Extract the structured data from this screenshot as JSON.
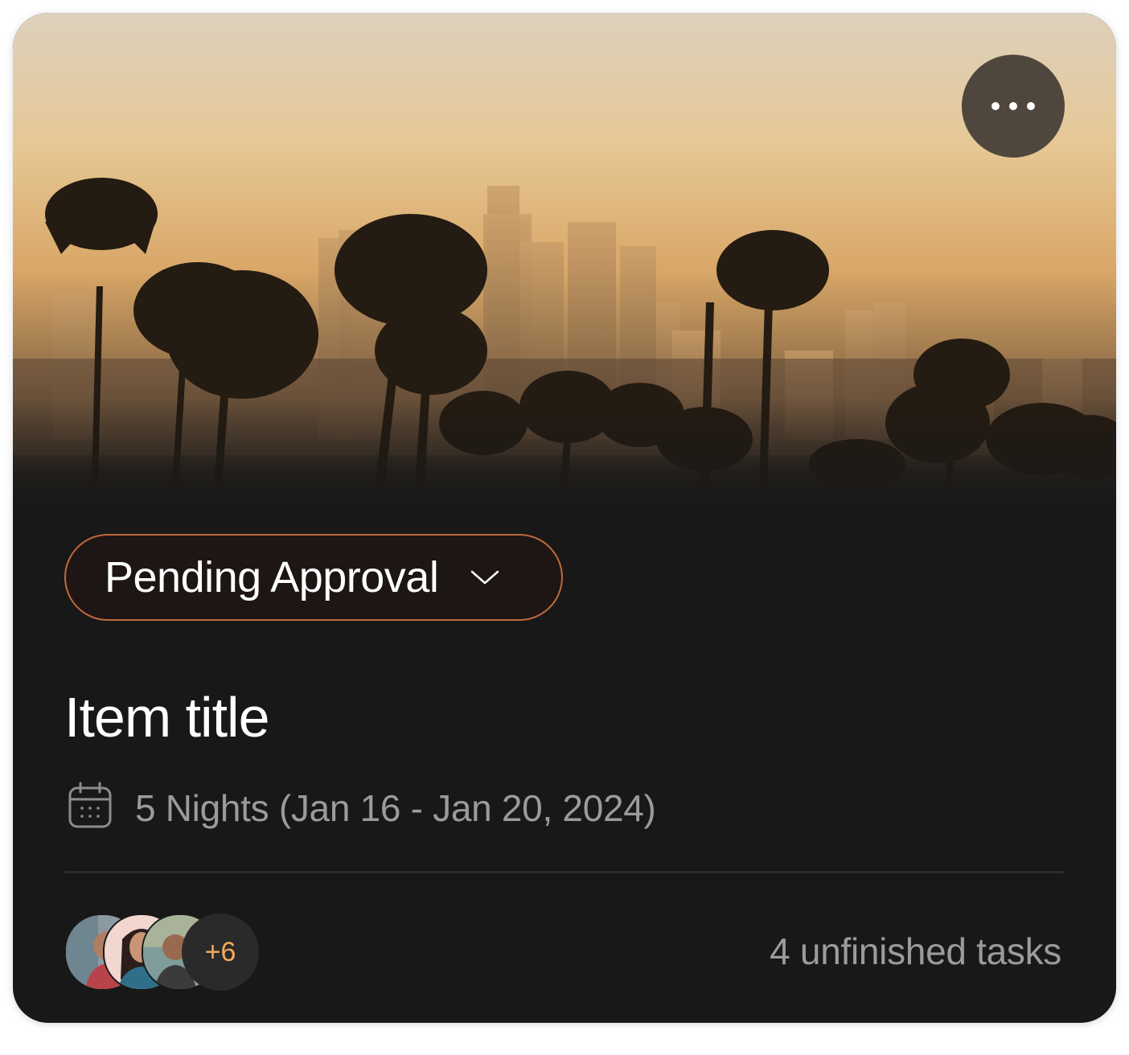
{
  "card": {
    "status": {
      "label": "Pending Approval"
    },
    "title": "Item title",
    "dates": "5 Nights (Jan 16 - Jan 20, 2024)",
    "participants": {
      "extra_count": "+6"
    },
    "tasks": "4 unfinished tasks"
  },
  "icons": {
    "more": "more-horizontal-icon",
    "status_dropdown": "chevron-down-icon",
    "date": "calendar-icon"
  },
  "colors": {
    "card_background": "#181818",
    "pill_border": "#c06a3c",
    "more_count_text": "#f3a95b",
    "muted_text": "#9b9b9b"
  }
}
